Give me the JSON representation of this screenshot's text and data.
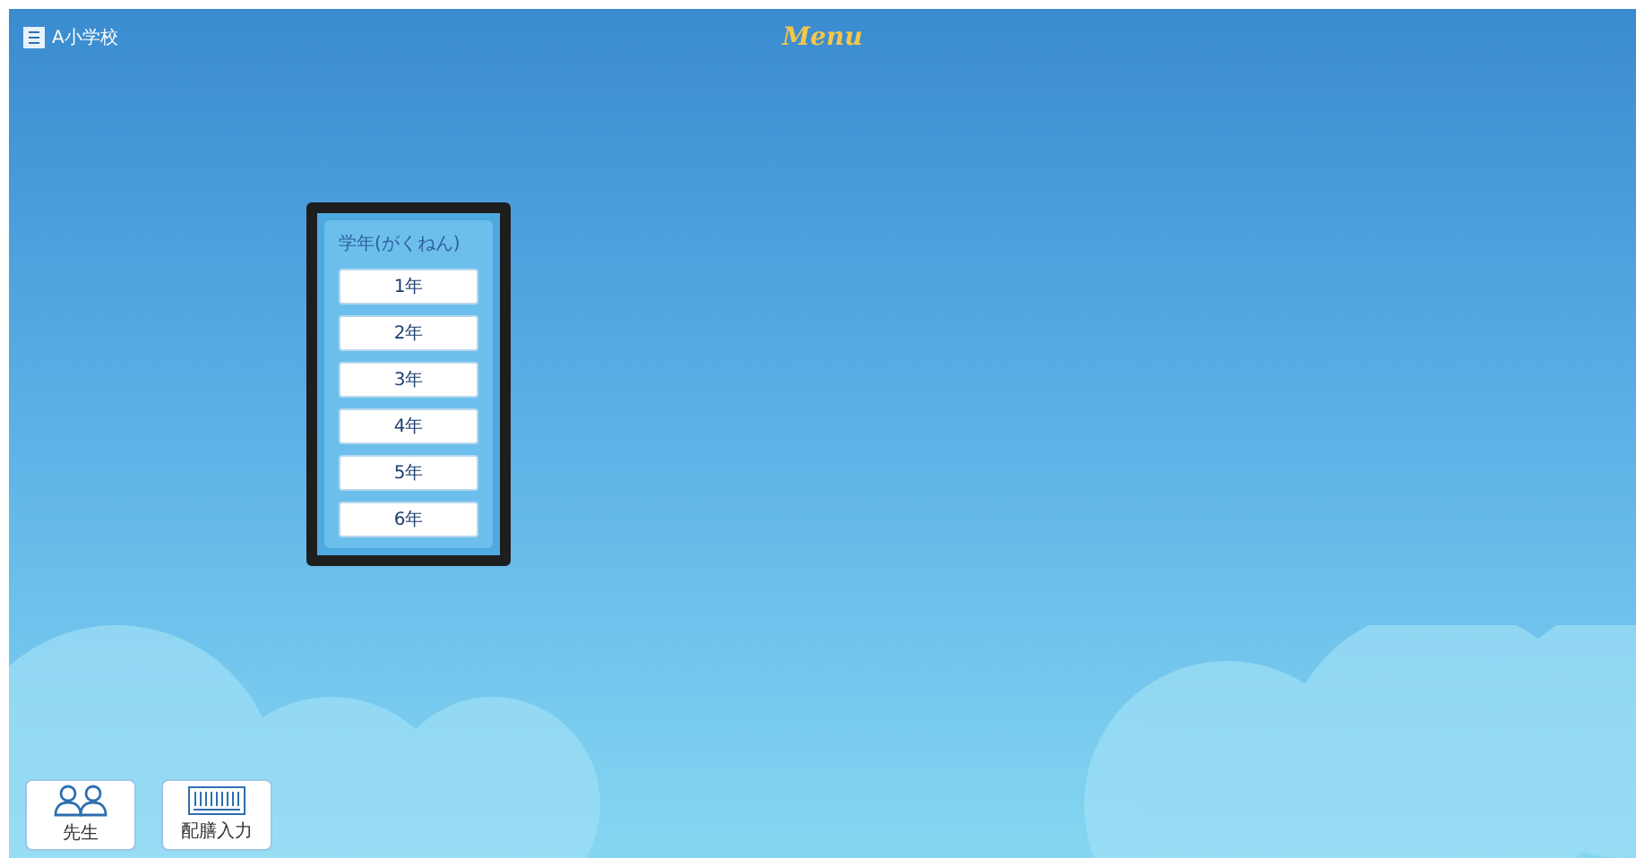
{
  "header": {
    "school": "A小学校",
    "logo": "Menu"
  },
  "grade_panel": {
    "title": "学年(がくねん)",
    "grades": [
      {
        "label": "1年"
      },
      {
        "label": "2年"
      },
      {
        "label": "3年"
      },
      {
        "label": "4年"
      },
      {
        "label": "5年"
      },
      {
        "label": "6年"
      }
    ]
  },
  "bottom_buttons": [
    {
      "kind": "teacher",
      "label": "先生"
    },
    {
      "kind": "keyboard",
      "label": "配膳入力"
    }
  ]
}
